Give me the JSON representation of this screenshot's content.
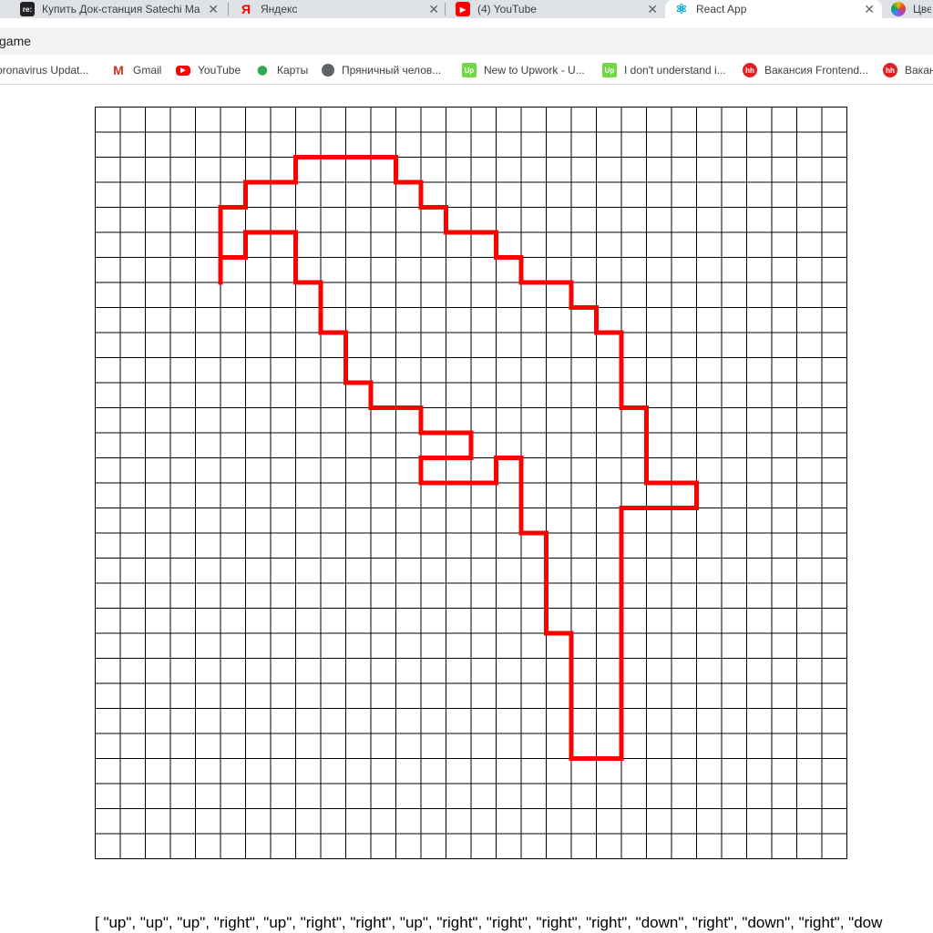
{
  "tabs": [
    {
      "title": "Купить Док-станция Satechi Ma",
      "icon": "re-favicon",
      "badge": "re:",
      "color": "#222222",
      "active": false
    },
    {
      "title": "Яндекс",
      "icon": "yandex-favicon",
      "badge": "Я",
      "color": "#ff0000",
      "active": false
    },
    {
      "title": "(4) YouTube",
      "icon": "youtube-favicon",
      "badge": "▶",
      "color": "#ff0000",
      "active": false
    },
    {
      "title": "React App",
      "icon": "react-favicon",
      "badge": "⚛",
      "color": "#00a8d8",
      "active": true
    },
    {
      "title": "Цве",
      "icon": "color-favicon",
      "badge": "",
      "color": "#e0679a",
      "active": false
    }
  ],
  "address": {
    "url": "game"
  },
  "bookmarks": [
    {
      "label": "oronavirus Updat...",
      "icon": "none",
      "color": ""
    },
    {
      "label": "Gmail",
      "icon": "gmail-icon",
      "color": "#d93025"
    },
    {
      "label": "YouTube",
      "icon": "youtube-icon",
      "color": "#ff0000"
    },
    {
      "label": "Карты",
      "icon": "maps-icon",
      "color": "#34a853"
    },
    {
      "label": "Пряничный челов...",
      "icon": "globe-icon",
      "color": "#5f6368"
    },
    {
      "label": "New to Upwork - U...",
      "icon": "upwork-icon",
      "color": "#6fda44"
    },
    {
      "label": "I don't understand i...",
      "icon": "upwork-icon",
      "color": "#6fda44"
    },
    {
      "label": "Вакансия Frontend...",
      "icon": "hh-icon",
      "color": "#e02027"
    },
    {
      "label": "Ваканс",
      "icon": "hh-icon",
      "color": "#e02027"
    }
  ],
  "game": {
    "grid_columns": 30,
    "grid_rows": 30,
    "path_color": "#ff0000",
    "grid_line_color": "#000000",
    "start_cell": [
      5,
      7
    ],
    "moves": [
      "up",
      "up",
      "up",
      "right",
      "up",
      "right",
      "right",
      "up",
      "right",
      "right",
      "right",
      "right",
      "down",
      "right",
      "down",
      "right",
      "down",
      "right",
      "right",
      "down",
      "right",
      "down",
      "right",
      "right",
      "down",
      "right",
      "down",
      "right",
      "down",
      "down",
      "down",
      "right",
      "down",
      "down",
      "down",
      "right",
      "right",
      "down",
      "left",
      "left",
      "left",
      "down",
      "down",
      "down",
      "down",
      "down",
      "down",
      "down",
      "down",
      "down",
      "down",
      "left",
      "left",
      "up",
      "up",
      "up",
      "up",
      "up",
      "left",
      "up",
      "up",
      "up",
      "up",
      "left",
      "up",
      "up",
      "up",
      "left",
      "down",
      "left",
      "left",
      "left",
      "up",
      "right",
      "right",
      "up",
      "left",
      "left",
      "up",
      "left",
      "left",
      "up",
      "left",
      "up",
      "up",
      "left",
      "up",
      "up",
      "left",
      "up",
      "up",
      "left",
      "left",
      "down",
      "left"
    ],
    "moves_text": "[ \"up\", \"up\", \"up\", \"right\", \"up\", \"right\", \"right\", \"up\", \"right\", \"right\", \"right\", \"right\", \"down\", \"right\", \"down\", \"right\", \"dow"
  }
}
